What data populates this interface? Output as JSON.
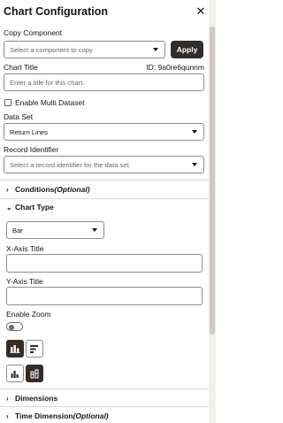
{
  "panel": {
    "title": "Chart Configuration",
    "close_icon": "close-icon"
  },
  "copy_component": {
    "label": "Copy Component",
    "placeholder": "Select a component to copy",
    "apply_label": "Apply"
  },
  "chart_title": {
    "label": "Chart Title",
    "id_text": "ID: 9a0re6qunnm",
    "placeholder": "Enter a title for this chart."
  },
  "multi_dataset": {
    "label": "Enable Multi Dataset",
    "checked": false
  },
  "data_set": {
    "label": "Data Set",
    "value": "Return Lines"
  },
  "record_identifier": {
    "label": "Record Identifier",
    "placeholder": "Select a record identifier for the data set."
  },
  "conditions": {
    "label": "Conditions",
    "optional": "(Optional)",
    "expanded": false
  },
  "chart_type": {
    "label": "Chart Type",
    "expanded": true,
    "value": "Bar"
  },
  "x_axis": {
    "label": "X-Axis Title",
    "value": ""
  },
  "y_axis": {
    "label": "Y-Axis Title",
    "value": ""
  },
  "zoom": {
    "label": "Enable Zoom",
    "enabled": false
  },
  "orientation_buttons": [
    {
      "name": "vertical-bars-icon",
      "selected": true
    },
    {
      "name": "horizontal-bars-icon",
      "selected": false
    }
  ],
  "stack_buttons": [
    {
      "name": "grouped-bars-icon",
      "selected": false
    },
    {
      "name": "stacked-bars-icon",
      "selected": true
    }
  ],
  "dimensions": {
    "label": "Dimensions",
    "expanded": false
  },
  "time_dimension": {
    "label": "Time Dimension",
    "optional": "(Optional)",
    "expanded": false
  },
  "colors": {
    "dark": "#312d2a",
    "border": "#8f8b87",
    "text": "#161513"
  }
}
